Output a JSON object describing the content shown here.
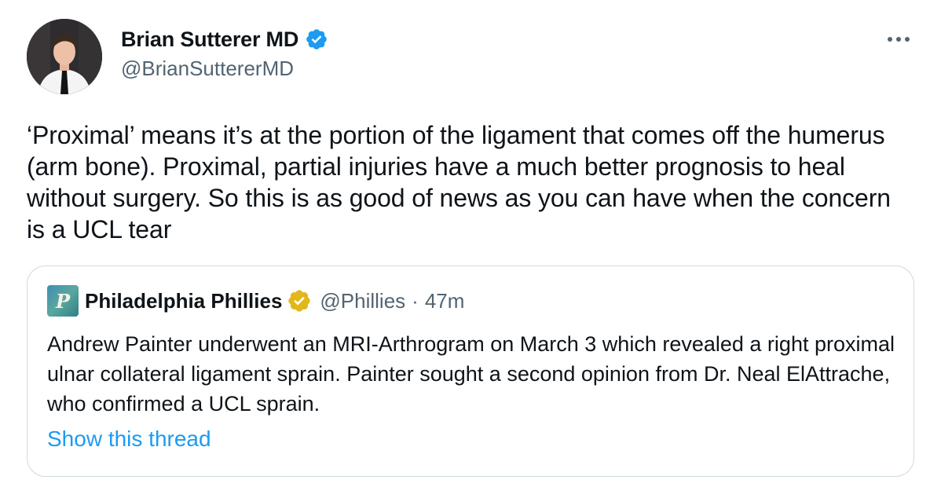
{
  "author": {
    "name": "Brian Sutterer MD",
    "handle": "@BrianSuttererMD",
    "verified_icon": "blue-verified-badge"
  },
  "menu": {
    "icon": "more-options-icon"
  },
  "tweet": {
    "text": "‘Proximal’ means it’s at the portion of the ligament that comes off the humerus (arm bone). Proximal, partial injuries have a much better prognosis to heal without surgery. So this is as good of news as you can have when the concern is a UCL tear"
  },
  "quoted_tweet": {
    "author_name": "Philadelphia Phillies",
    "handle": "@Phillies",
    "separator": "·",
    "time": "47m",
    "badge_icon": "gold-verified-badge",
    "text": "Andrew Painter underwent an MRI-Arthrogram on March 3 which revealed a right proximal ulnar collateral ligament sprain. Painter sought a second opinion from Dr. Neal ElAttrache, who confirmed a UCL sprain.",
    "show_thread_label": "Show this thread",
    "avatar_letter": "P"
  },
  "colors": {
    "text_primary": "#0f1419",
    "text_secondary": "#536471",
    "link": "#1d9bf0",
    "verified_blue": "#1d9bf0",
    "verified_gold": "#e2b719",
    "border": "#cfd9de"
  }
}
